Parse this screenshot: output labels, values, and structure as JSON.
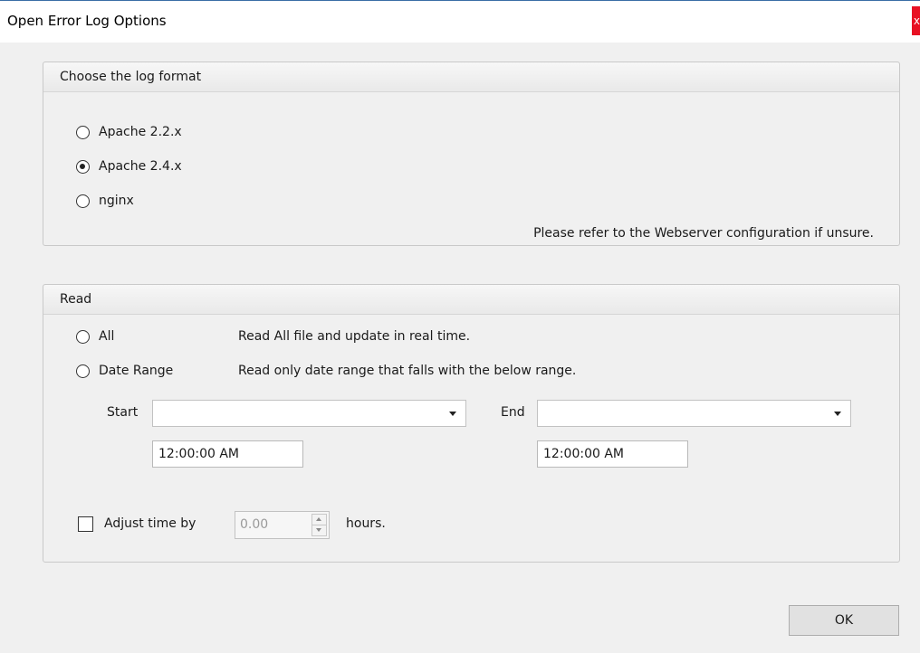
{
  "window": {
    "title": "Open Error Log Options",
    "close_label": "x"
  },
  "format_group": {
    "header": "Choose the log format",
    "options": [
      {
        "label": "Apache 2.2.x",
        "checked": false
      },
      {
        "label": "Apache 2.4.x",
        "checked": true
      },
      {
        "label": "nginx",
        "checked": false
      }
    ],
    "hint": "Please refer to the Webserver configuration if unsure."
  },
  "read_group": {
    "header": "Read",
    "all_label": "All",
    "all_desc": "Read All file and update in real time.",
    "range_label": "Date Range",
    "range_desc": "Read only date range that falls with the below range.",
    "start_label": "Start",
    "start_date": "",
    "start_time": "12:00:00 AM",
    "end_label": "End",
    "end_date": "",
    "end_time": "12:00:00 AM",
    "adjust_label": "Adjust time by",
    "adjust_value": "0.00",
    "hours_label": "hours."
  },
  "buttons": {
    "ok": "OK"
  }
}
